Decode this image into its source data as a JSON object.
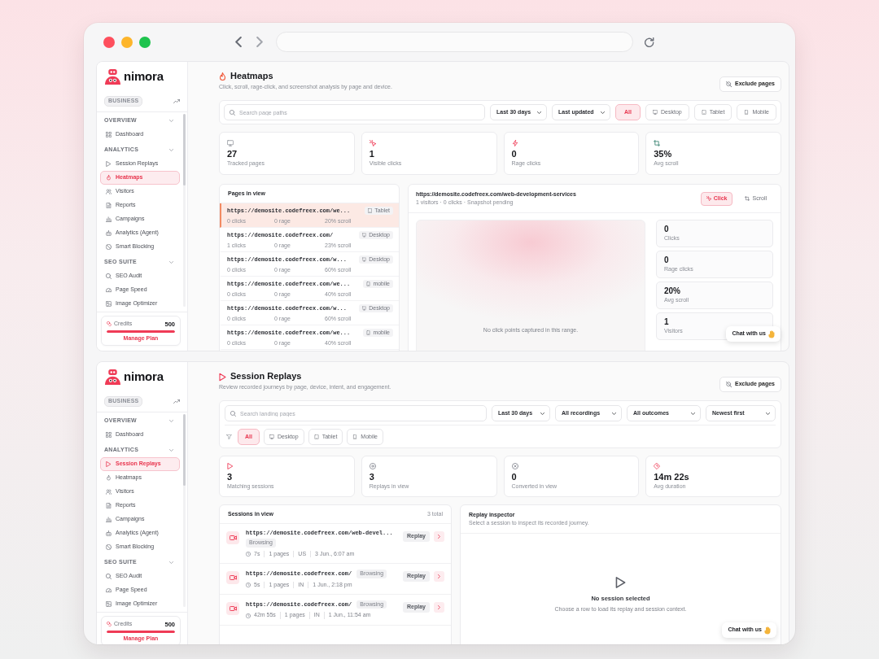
{
  "heatmaps_screen": {
    "sidebar": {
      "brand": "nimora",
      "plan": "BUSINESS",
      "sections": [
        {
          "title": "OVERVIEW",
          "expanded": true,
          "items": [
            {
              "kind": "dashboard",
              "label": "Dashboard",
              "selected": false
            }
          ]
        },
        {
          "title": "ANALYTICS",
          "expanded": true,
          "items": [
            {
              "kind": "replays",
              "label": "Session Replays",
              "selected": false
            },
            {
              "kind": "heatmaps",
              "label": "Heatmaps",
              "selected": true
            },
            {
              "kind": "visitors",
              "label": "Visitors",
              "selected": false
            },
            {
              "kind": "reports",
              "label": "Reports",
              "selected": false
            },
            {
              "kind": "campaigns",
              "label": "Campaigns",
              "selected": false
            },
            {
              "kind": "agent",
              "label": "Analytics (Agent)",
              "selected": false
            },
            {
              "kind": "blocking",
              "label": "Smart Blocking",
              "selected": false
            }
          ]
        },
        {
          "title": "SEO SUITE",
          "expanded": true,
          "items": [
            {
              "kind": "audit",
              "label": "SEO Audit",
              "selected": false
            },
            {
              "kind": "speed",
              "label": "Page Speed",
              "selected": false
            },
            {
              "kind": "images",
              "label": "Image Optimizer",
              "selected": false
            }
          ]
        }
      ],
      "credits": {
        "label": "Credits",
        "value": "500",
        "level": 1,
        "action": "Manage Plan"
      }
    },
    "header": {
      "title": "Heatmaps",
      "subtitle": "Click, scroll, rage-click, and screenshot analysis by page and device.",
      "action": "Exclude pages"
    },
    "filters": {
      "search": {
        "placeholder": "Search page paths"
      },
      "dropdowns": [
        "Last 30 days",
        "Last updated"
      ],
      "devices": [
        {
          "kind": "all",
          "label": "All",
          "selected": true
        },
        {
          "kind": "desktop",
          "label": "Desktop",
          "selected": false
        },
        {
          "kind": "tablet",
          "label": "Tablet",
          "selected": false
        },
        {
          "kind": "mobile",
          "label": "Mobile",
          "selected": false
        }
      ]
    },
    "stats": [
      {
        "kind": "pages",
        "value": "27",
        "label": "Tracked pages"
      },
      {
        "kind": "clicks",
        "value": "1",
        "label": "Visible clicks"
      },
      {
        "kind": "rage",
        "value": "0",
        "label": "Rage clicks"
      },
      {
        "kind": "scroll",
        "value": "35%",
        "label": "Avg scroll"
      }
    ],
    "pages": {
      "title": "Pages in view",
      "rows": [
        {
          "url": "https://demosite.codefreex.com/we...",
          "device": {
            "kind": "tablet",
            "label": "Tablet"
          },
          "clicks": "0 clicks",
          "rage": "0 rage",
          "scroll": "20% scroll",
          "selected": true
        },
        {
          "url": "https://demosite.codefreex.com/",
          "device": {
            "kind": "desktop",
            "label": "Desktop"
          },
          "clicks": "1 clicks",
          "rage": "0 rage",
          "scroll": "23% scroll",
          "selected": false
        },
        {
          "url": "https://demosite.codefreex.com/w...",
          "device": {
            "kind": "desktop",
            "label": "Desktop"
          },
          "clicks": "0 clicks",
          "rage": "0 rage",
          "scroll": "60% scroll",
          "selected": false
        },
        {
          "url": "https://demosite.codefreex.com/we...",
          "device": {
            "kind": "mobile",
            "label": "mobile"
          },
          "clicks": "0 clicks",
          "rage": "0 rage",
          "scroll": "40% scroll",
          "selected": false
        },
        {
          "url": "https://demosite.codefreex.com/w...",
          "device": {
            "kind": "desktop",
            "label": "Desktop"
          },
          "clicks": "0 clicks",
          "rage": "0 rage",
          "scroll": "60% scroll",
          "selected": false
        },
        {
          "url": "https://demosite.codefreex.com/we...",
          "device": {
            "kind": "mobile",
            "label": "mobile"
          },
          "clicks": "0 clicks",
          "rage": "0 rage",
          "scroll": "40% scroll",
          "selected": false
        }
      ]
    },
    "detail": {
      "url": "https://demosite.codefreex.com/web-development-services",
      "meta": "1 visitors · 0 clicks · Snapshot pending",
      "modes": [
        {
          "kind": "click",
          "label": "Click",
          "selected": true
        },
        {
          "kind": "scroll",
          "label": "Scroll",
          "selected": false
        }
      ],
      "empty_message": "No click points captured in this range.",
      "metrics": [
        {
          "value": "0",
          "label": "Clicks"
        },
        {
          "value": "0",
          "label": "Rage clicks"
        },
        {
          "value": "20%",
          "label": "Avg scroll"
        },
        {
          "value": "1",
          "label": "Visitors"
        }
      ]
    },
    "chat": {
      "label": "Chat with us"
    }
  },
  "replays_screen": {
    "sidebar": {
      "brand": "nimora",
      "plan": "BUSINESS",
      "sections": [
        {
          "title": "OVERVIEW",
          "expanded": true,
          "items": [
            {
              "kind": "dashboard",
              "label": "Dashboard",
              "selected": false
            }
          ]
        },
        {
          "title": "ANALYTICS",
          "expanded": true,
          "items": [
            {
              "kind": "replays",
              "label": "Session Replays",
              "selected": true
            },
            {
              "kind": "heatmaps",
              "label": "Heatmaps",
              "selected": false
            },
            {
              "kind": "visitors",
              "label": "Visitors",
              "selected": false
            },
            {
              "kind": "reports",
              "label": "Reports",
              "selected": false
            },
            {
              "kind": "campaigns",
              "label": "Campaigns",
              "selected": false
            },
            {
              "kind": "agent",
              "label": "Analytics (Agent)",
              "selected": false
            },
            {
              "kind": "blocking",
              "label": "Smart Blocking",
              "selected": false
            }
          ]
        },
        {
          "title": "SEO SUITE",
          "expanded": true,
          "items": [
            {
              "kind": "audit",
              "label": "SEO Audit",
              "selected": false
            },
            {
              "kind": "speed",
              "label": "Page Speed",
              "selected": false
            },
            {
              "kind": "images",
              "label": "Image Optimizer",
              "selected": false
            }
          ]
        }
      ],
      "credits": {
        "label": "Credits",
        "value": "500",
        "level": 1,
        "action": "Manage Plan"
      }
    },
    "header": {
      "title": "Session Replays",
      "subtitle": "Review recorded journeys by page, device, intent, and engagement.",
      "action": "Exclude pages"
    },
    "filters": {
      "search": {
        "placeholder": "Search landing pages"
      },
      "dropdowns": [
        "Last 30 days",
        "All recordings",
        "All outcomes",
        "Newest first"
      ],
      "devices": [
        {
          "kind": "all",
          "label": "All",
          "selected": true
        },
        {
          "kind": "desktop",
          "label": "Desktop",
          "selected": false
        },
        {
          "kind": "tablet",
          "label": "Tablet",
          "selected": false
        },
        {
          "kind": "mobile",
          "label": "Mobile",
          "selected": false
        }
      ]
    },
    "stats": [
      {
        "kind": "sessions",
        "value": "3",
        "label": "Matching sessions"
      },
      {
        "kind": "replays",
        "value": "3",
        "label": "Replays in view"
      },
      {
        "kind": "conversions",
        "value": "0",
        "label": "Converted in view"
      },
      {
        "kind": "duration",
        "value": "14m 22s",
        "label": "Avg duration"
      }
    ],
    "sessions": {
      "title": "Sessions in view",
      "count": "3 total",
      "rows": [
        {
          "url": "https://demosite.codefreex.com/web-devel...",
          "tag": "Browsing",
          "duration": "7s",
          "pages": "1 pages",
          "country": "US",
          "time": "3 Jun., 6:07 am",
          "action": "Replay"
        },
        {
          "url": "https://demosite.codefreex.com/",
          "tag": "Browsing",
          "duration": "5s",
          "pages": "1 pages",
          "country": "IN",
          "time": "1 Jun., 2:18 pm",
          "action": "Replay"
        },
        {
          "url": "https://demosite.codefreex.com/",
          "tag": "Browsing",
          "duration": "42m 55s",
          "pages": "1 pages",
          "country": "IN",
          "time": "1 Jun., 11:54 am",
          "action": "Replay"
        }
      ]
    },
    "inspector": {
      "title": "Replay inspector",
      "subtitle": "Select a session to inspect its recorded journey.",
      "empty_title": "No session selected",
      "empty_text": "Choose a row to load its replay and session context."
    },
    "chat": {
      "label": "Chat with us"
    }
  }
}
